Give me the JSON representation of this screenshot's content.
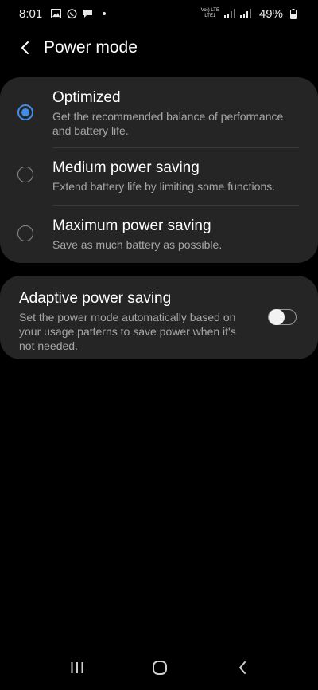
{
  "status_bar": {
    "time": "8:01",
    "notification_icons": [
      "gallery-icon",
      "whatsapp-icon",
      "message-icon"
    ],
    "network_top": "Vo)) LTE",
    "network_bottom": "LTE1",
    "battery_percent": "49%"
  },
  "header": {
    "title": "Power mode"
  },
  "modes": [
    {
      "title": "Optimized",
      "description": "Get the recommended balance of performance and battery life.",
      "selected": true
    },
    {
      "title": "Medium power saving",
      "description": "Extend battery life by limiting some functions.",
      "selected": false
    },
    {
      "title": "Maximum power saving",
      "description": "Save as much battery as possible.",
      "selected": false
    }
  ],
  "adaptive": {
    "title": "Adaptive power saving",
    "description": "Set the power mode automatically based on your usage patterns to save power when it's not needed.",
    "enabled": false
  },
  "colors": {
    "background": "#000000",
    "card": "#252525",
    "accent": "#3f8fe8",
    "secondary_text": "#a6a6a6"
  },
  "nav_bar": {
    "buttons": [
      "recents-icon",
      "home-icon",
      "back-icon"
    ]
  }
}
